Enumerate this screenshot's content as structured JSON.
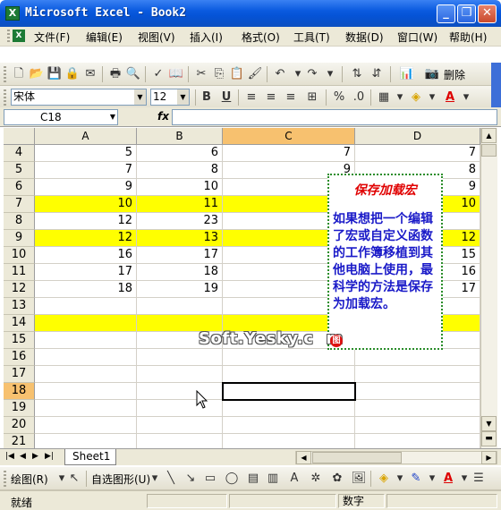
{
  "window": {
    "title": "Microsoft Excel - Book2",
    "minimize": "_",
    "restore": "❐",
    "close": "✕"
  },
  "menu": {
    "items": [
      "文件(F)",
      "编辑(E)",
      "视图(V)",
      "插入(I)",
      "格式(O)",
      "工具(T)",
      "数据(D)",
      "窗口(W)",
      "帮助(H)"
    ],
    "mdi_min": "_",
    "mdi_restore": "❐",
    "mdi_close": "✕"
  },
  "toolbar_standard": {
    "delete_label": "删除"
  },
  "toolbar_format": {
    "font": "宋体",
    "size": "12",
    "bold": "B",
    "underline": "U",
    "percent": "%"
  },
  "formula_bar": {
    "name_box": "C18",
    "fx": "fx",
    "value": ""
  },
  "grid": {
    "columns": [
      "A",
      "B",
      "C",
      "D"
    ],
    "active_column": "C",
    "active_row": "18",
    "rows": [
      {
        "num": "4",
        "A": "5",
        "B": "6",
        "C": "7",
        "D": "7",
        "highlight": false
      },
      {
        "num": "5",
        "A": "7",
        "B": "8",
        "C": "9",
        "D": "8",
        "highlight": false
      },
      {
        "num": "6",
        "A": "9",
        "B": "10",
        "C": "",
        "D": "9",
        "highlight": false
      },
      {
        "num": "7",
        "A": "10",
        "B": "11",
        "C": "",
        "D": "10",
        "highlight": true
      },
      {
        "num": "8",
        "A": "12",
        "B": "23",
        "C": "",
        "D": "",
        "highlight": false
      },
      {
        "num": "9",
        "A": "12",
        "B": "13",
        "C": "",
        "D": "12",
        "highlight": true
      },
      {
        "num": "10",
        "A": "16",
        "B": "17",
        "C": "",
        "D": "15",
        "highlight": false
      },
      {
        "num": "11",
        "A": "17",
        "B": "18",
        "C": "",
        "D": "16",
        "highlight": false
      },
      {
        "num": "12",
        "A": "18",
        "B": "19",
        "C": "",
        "D": "17",
        "highlight": false
      },
      {
        "num": "13",
        "A": "",
        "B": "",
        "C": "",
        "D": "",
        "highlight": false
      },
      {
        "num": "14",
        "A": "",
        "B": "",
        "C": "",
        "D": "",
        "highlight": true
      },
      {
        "num": "15",
        "A": "",
        "B": "",
        "C": "",
        "D": "",
        "highlight": false
      },
      {
        "num": "16",
        "A": "",
        "B": "",
        "C": "",
        "D": "",
        "highlight": false
      },
      {
        "num": "17",
        "A": "",
        "B": "",
        "C": "",
        "D": "",
        "highlight": false
      },
      {
        "num": "18",
        "A": "",
        "B": "",
        "C": "",
        "D": "",
        "highlight": false
      },
      {
        "num": "19",
        "A": "",
        "B": "",
        "C": "",
        "D": "",
        "highlight": false
      },
      {
        "num": "20",
        "A": "",
        "B": "",
        "C": "",
        "D": "",
        "highlight": false
      },
      {
        "num": "21",
        "A": "",
        "B": "",
        "C": "",
        "D": "",
        "highlight": false
      }
    ]
  },
  "callout": {
    "title": "保存加载宏",
    "body": "如果想把一个编辑了宏或自定义函数的工作簿移植到其他电脑上使用，最科学的方法是保存为加载宏。"
  },
  "watermark": {
    "text": "Soft.Yesky.c",
    "tail": "m",
    "badge": "图"
  },
  "sheets": {
    "tabs": [
      "Sheet1"
    ]
  },
  "drawing_toolbar": {
    "draw_label": "绘图(R)",
    "autoshape_label": "自选图形(U)"
  },
  "status": {
    "ready": "就绪",
    "numlock": "数字"
  },
  "colors": {
    "highlight": "#ffff00",
    "callout_title": "#e00000",
    "callout_body": "#1a1ac8",
    "callout_border": "#2a8d2a"
  }
}
